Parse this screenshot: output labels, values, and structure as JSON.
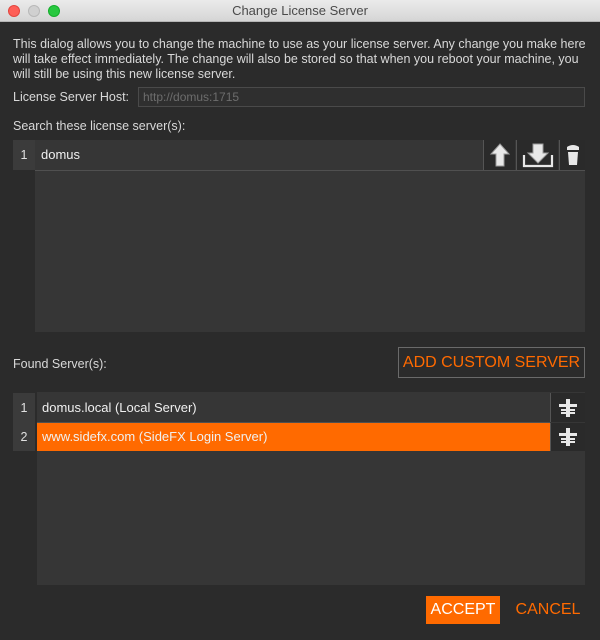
{
  "window": {
    "title": "Change License Server"
  },
  "description": "This dialog allows you to change the machine to use as your license server.  Any change you make here will take effect immediately.  The change will also be stored so that when you reboot your machine, you will still be using this new license server.",
  "host": {
    "label": "License Server Host:",
    "value": "",
    "placeholder": "http://domus:1715"
  },
  "search": {
    "label": "Search these license server(s):",
    "rows": [
      {
        "num": "1",
        "text": "domus"
      }
    ],
    "icons": [
      "arrow-up-icon",
      "arrow-down-icon",
      "trash-icon"
    ]
  },
  "found": {
    "label": "Found Server(s):",
    "add_custom_label": "ADD CUSTOM SERVER",
    "rows": [
      {
        "num": "1",
        "text": "domus.local (Local Server)"
      },
      {
        "num": "2",
        "text": "www.sidefx.com (SideFX Login Server)"
      }
    ],
    "row_icon": "add-to-list-icon"
  },
  "actions": {
    "accept_label": "ACCEPT",
    "cancel_label": "CANCEL"
  },
  "colors": {
    "accent": "#ff6a00",
    "background": "#2b2b2b"
  }
}
